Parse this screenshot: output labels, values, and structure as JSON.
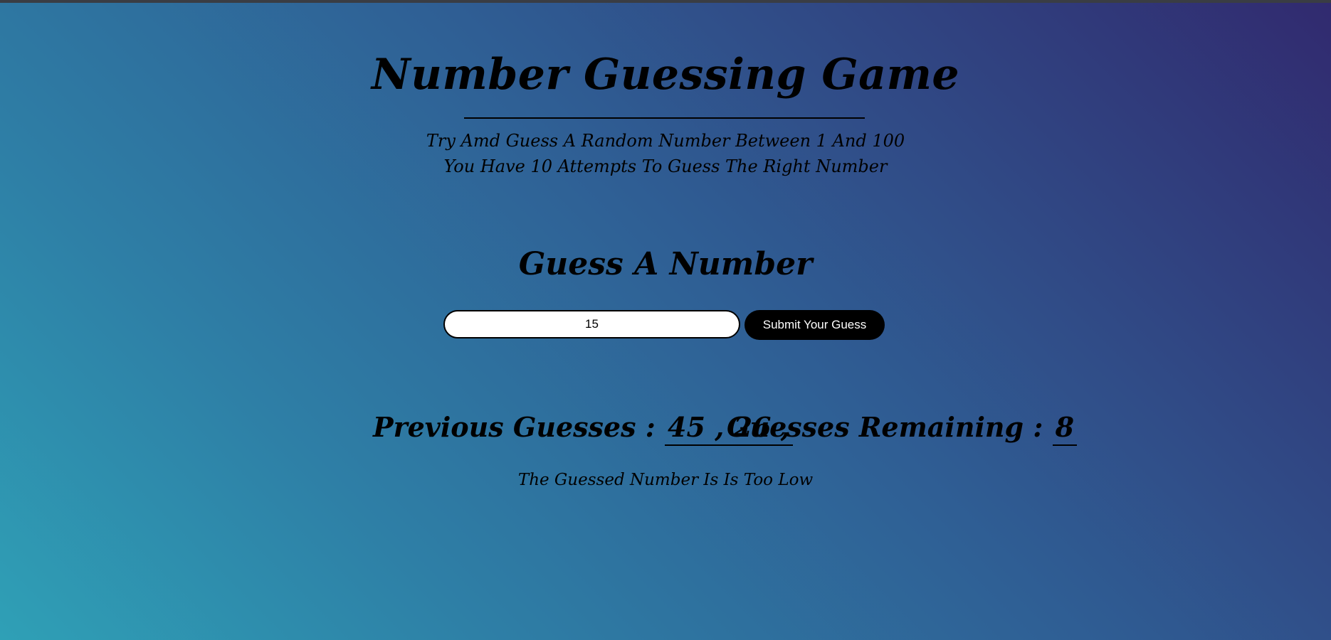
{
  "game": {
    "title": "Number Guessing Game",
    "instructions_line1": "Try Amd Guess A Random Number Between 1 And 100",
    "instructions_line2": "You Have 10 Attempts To Guess The Right Number"
  },
  "form": {
    "heading": "Guess A Number",
    "input_value": "15",
    "submit_label": "Submit Your Guess"
  },
  "stats": {
    "previous_label": "Previous Guesses :",
    "previous_value": "45 , 26 ,",
    "remaining_label": "Guesses Remaining :",
    "remaining_value": "8"
  },
  "feedback": {
    "message": "The Guessed Number Is Is Too Low"
  },
  "colors": {
    "gradient_start": "#2fa0b6",
    "gradient_end": "#312a6f",
    "button_bg": "#000000",
    "button_text": "#ffffff"
  }
}
